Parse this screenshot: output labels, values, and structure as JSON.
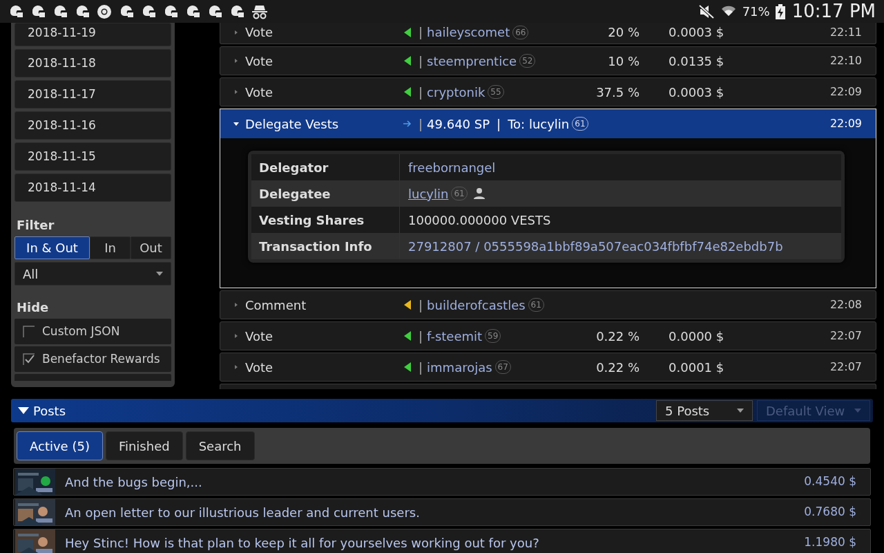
{
  "status_bar": {
    "battery": "71%",
    "time": "10:17 PM"
  },
  "dates": [
    "2018-11-19",
    "2018-11-18",
    "2018-11-17",
    "2018-11-16",
    "2018-11-15",
    "2018-11-14"
  ],
  "filter": {
    "label": "Filter",
    "options": [
      {
        "label": "In & Out",
        "selected": true
      },
      {
        "label": "In",
        "selected": false
      },
      {
        "label": "Out",
        "selected": false
      }
    ],
    "select": {
      "value": "All"
    }
  },
  "hide": {
    "label": "Hide",
    "items": [
      {
        "label": "Custom JSON",
        "checked": false
      },
      {
        "label": "Benefactor Rewards",
        "checked": true
      }
    ]
  },
  "operations": [
    {
      "type": "Vote",
      "kind": "vote",
      "color": "#3fcf3f",
      "expanded": false,
      "separator": "|",
      "user": "haileyscomet",
      "badge": "66",
      "percent": "20 %",
      "value": "0.0003 $",
      "time": "22:11"
    },
    {
      "type": "Vote",
      "kind": "vote",
      "color": "#3fcf3f",
      "expanded": false,
      "separator": "|",
      "user": "steemprentice",
      "badge": "52",
      "percent": "10 %",
      "value": "0.0135 $",
      "time": "22:10"
    },
    {
      "type": "Vote",
      "kind": "vote",
      "color": "#3fcf3f",
      "expanded": false,
      "separator": "|",
      "user": "cryptonik",
      "badge": "55",
      "percent": "37.5 %",
      "value": "0.0003 $",
      "time": "22:09"
    },
    {
      "type": "Delegate Vests",
      "kind": "delegate",
      "color": "#4a9be8",
      "expanded": true,
      "separator": "|",
      "amount": "49.640 SP",
      "separator_2": "|",
      "to": "To: lucylin",
      "badge": "61",
      "time": "22:09",
      "details": [
        {
          "label": "Delegator",
          "value": "freebornangel",
          "kind": "text"
        },
        {
          "label": "Delegatee",
          "value": "lucylin",
          "badge": "61",
          "kind": "user"
        },
        {
          "label": "Vesting Shares",
          "value": "100000.000000 VESTS",
          "kind": "plain"
        },
        {
          "label": "Transaction Info",
          "value": "27912807 / 0555598a1bbf89a507eac034fbfbf74e82ebdb7b",
          "kind": "text"
        }
      ]
    },
    {
      "type": "Comment",
      "kind": "comment",
      "color": "#e8b81c",
      "expanded": false,
      "separator": "|",
      "user": "builderofcastles",
      "badge": "61",
      "time": "22:08"
    },
    {
      "type": "Vote",
      "kind": "vote",
      "color": "#3fcf3f",
      "expanded": false,
      "separator": "|",
      "user": "f-steemit",
      "badge": "59",
      "percent": "0.22 %",
      "value": "0.0000 $",
      "time": "22:07"
    },
    {
      "type": "Vote",
      "kind": "vote",
      "color": "#3fcf3f",
      "expanded": false,
      "separator": "|",
      "user": "immarojas",
      "badge": "67",
      "percent": "0.22 %",
      "value": "0.0001 $",
      "time": "22:07"
    }
  ],
  "posts": {
    "title": "Posts",
    "count_select": "5 Posts",
    "view_select": {
      "value": "Default View",
      "disabled": true
    },
    "tabs": [
      {
        "label": "Active (5)",
        "selected": true
      },
      {
        "label": "Finished",
        "selected": false
      },
      {
        "label": "Search",
        "selected": false
      }
    ],
    "items": [
      {
        "title": "And the bugs begin,...",
        "payout": "0.4540 $",
        "kind": "picture"
      },
      {
        "title": "An open letter to our illustrious leader and current users.",
        "payout": "0.7680 $",
        "kind": "picture"
      },
      {
        "title": "Hey Stinc! How is that plan to keep it all for yourselves working out for you?",
        "payout": "1.1980 $",
        "kind": "picture"
      }
    ]
  }
}
